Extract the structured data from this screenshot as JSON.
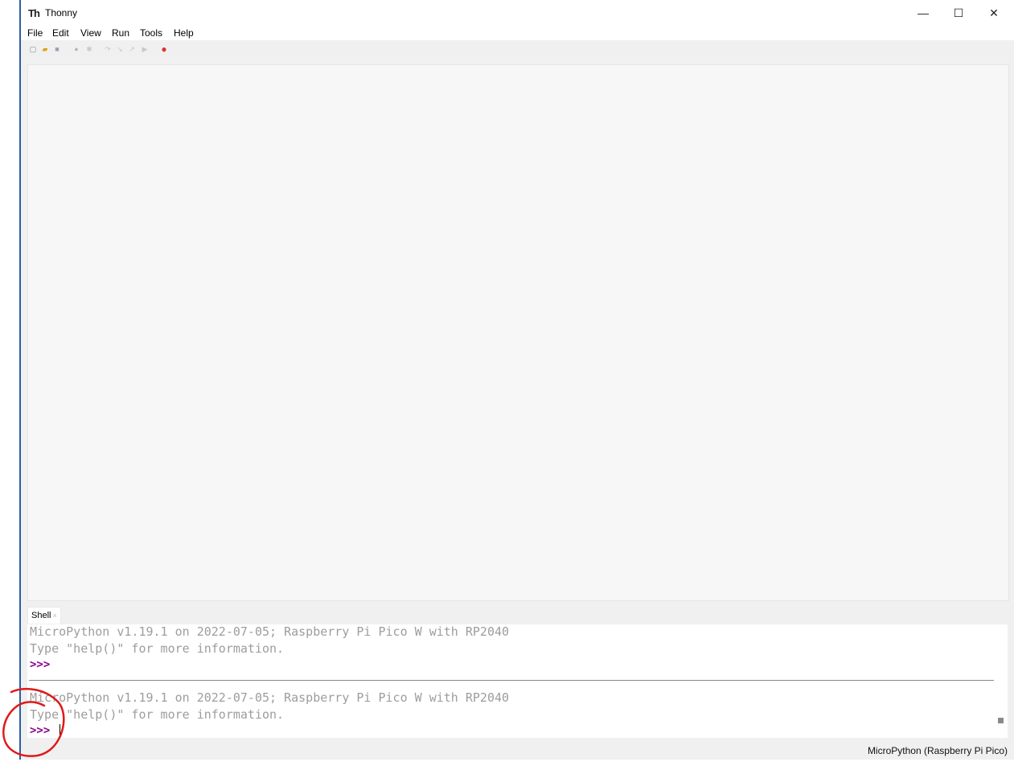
{
  "window": {
    "title": "Thonny",
    "logo": "Th",
    "controls": {
      "minimize": "—",
      "maximize": "☐",
      "close": "✕"
    }
  },
  "menu": {
    "items": [
      "File",
      "Edit",
      "View",
      "Run",
      "Tools",
      "Help"
    ]
  },
  "toolbar": {
    "buttons": [
      {
        "name": "new-file-icon",
        "glyph": "▢",
        "color": "#7a8aa0"
      },
      {
        "name": "open-file-icon",
        "glyph": "▰",
        "color": "#d9a300"
      },
      {
        "name": "save-file-icon",
        "glyph": "■",
        "color": "#9aa3b0"
      },
      {
        "name": "run-icon",
        "glyph": "●",
        "color": "#b8b8b8"
      },
      {
        "name": "debug-icon",
        "glyph": "✱",
        "color": "#c8c8c8"
      },
      {
        "name": "step-over-icon",
        "glyph": "↷",
        "color": "#c8c8c8"
      },
      {
        "name": "step-into-icon",
        "glyph": "↘",
        "color": "#c8c8c8"
      },
      {
        "name": "step-out-icon",
        "glyph": "↗",
        "color": "#c8c8c8"
      },
      {
        "name": "resume-icon",
        "glyph": "▶",
        "color": "#c8c8c8"
      },
      {
        "name": "stop-icon",
        "glyph": "●",
        "color": "#e0322b"
      }
    ]
  },
  "shell": {
    "tab_label": "Shell",
    "tab_close": "×",
    "session1": {
      "banner": "MicroPython v1.19.1 on 2022-07-05; Raspberry Pi Pico W with RP2040",
      "help": "Type \"help()\" for more information.",
      "prompt": ">>>"
    },
    "session2": {
      "banner": "MicroPython v1.19.1 on 2022-07-05; Raspberry Pi Pico W with RP2040",
      "help": "Type \"help()\" for more information.",
      "prompt": ">>>"
    }
  },
  "status": {
    "interpreter": "MicroPython (Raspberry Pi Pico)"
  },
  "colors": {
    "prompt": "#8b008b",
    "output_text": "#9d9d9d",
    "annotation": "#e01919"
  }
}
